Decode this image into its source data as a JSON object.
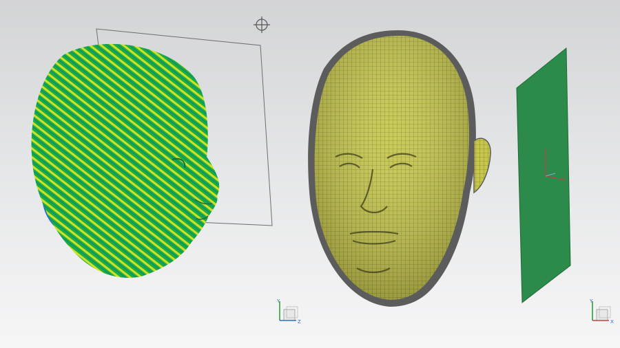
{
  "scene": {
    "background_top": "#d3d4d5",
    "background_bottom": "#f6f6f7",
    "left_model": {
      "name": "head-curvature-analysis",
      "stripe_colors": [
        "#1cae3c",
        "#c8e02a",
        "#23a24c",
        "#1f6fcf",
        "#e23a1c"
      ]
    },
    "right_model": {
      "name": "head-mesh",
      "fill": "#c4c447",
      "wire": "#5b5b25",
      "outline": "#5c5c5c"
    },
    "plane": {
      "fill": "#2c8a4a"
    },
    "cursor": {
      "icon": "crosshair-icon"
    }
  },
  "axis_triads": [
    {
      "id": "center",
      "labels": {
        "y": "Y",
        "z": "Z"
      }
    },
    {
      "id": "right",
      "labels": {
        "y": "Y",
        "x": "X"
      }
    }
  ]
}
